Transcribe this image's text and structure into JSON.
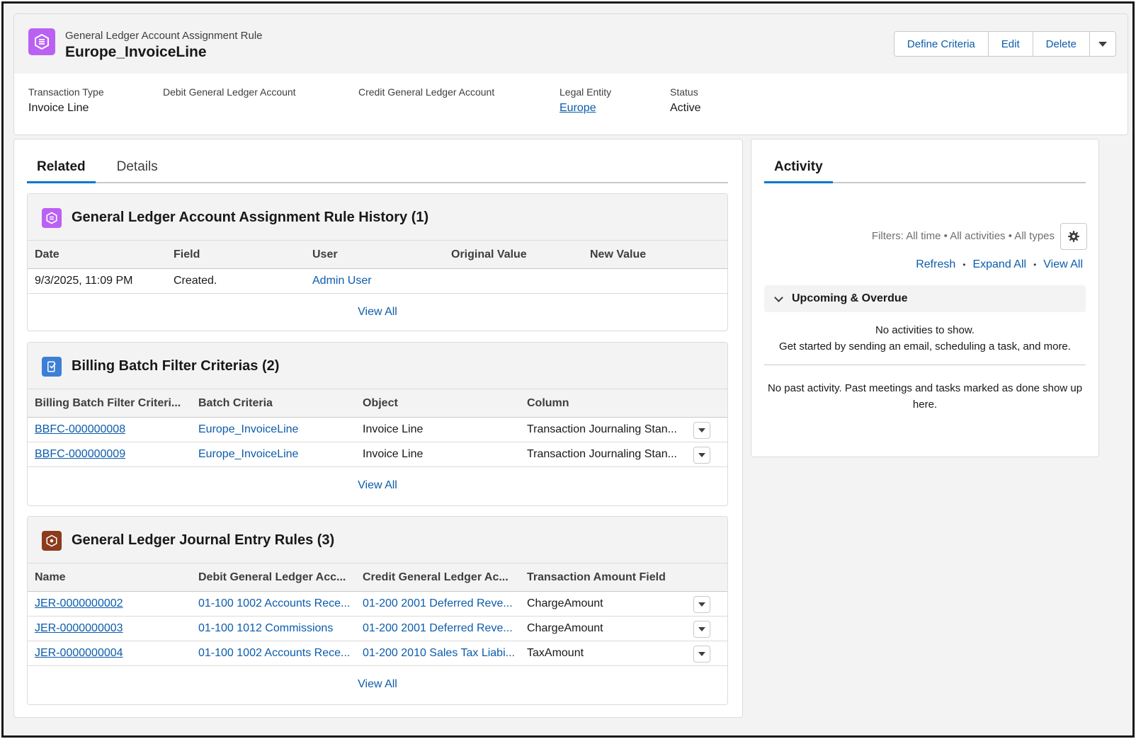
{
  "header": {
    "object_type": "General Ledger Account Assignment Rule",
    "record_name": "Europe_InvoiceLine",
    "icon": "assignment-rule-icon",
    "actions": [
      "Define Criteria",
      "Edit",
      "Delete"
    ],
    "fields": [
      {
        "label": "Transaction Type",
        "value": "Invoice Line"
      },
      {
        "label": "Debit General Ledger Account",
        "value": ""
      },
      {
        "label": "Credit General Ledger Account",
        "value": ""
      },
      {
        "label": "Legal Entity",
        "value": "Europe"
      },
      {
        "label": "Status",
        "value": "Active"
      }
    ]
  },
  "tabs": [
    "Related",
    "Details"
  ],
  "history": {
    "title": "General Ledger Account Assignment Rule History (1)",
    "columns": [
      "Date",
      "Field",
      "User",
      "Original Value",
      "New Value"
    ],
    "rows": [
      [
        "9/3/2025, 11:09 PM",
        "Created.",
        "Admin User",
        "",
        ""
      ]
    ],
    "view_all": "View All"
  },
  "filter_criterias": {
    "title": "Billing Batch Filter Criterias (2)",
    "columns": [
      "Billing Batch Filter Criteri...",
      "Batch Criteria",
      "Object",
      "Column"
    ],
    "rows": [
      [
        "BBFC-000000008",
        "Europe_InvoiceLine",
        "Invoice Line",
        "Transaction Journaling Stan..."
      ],
      [
        "BBFC-000000009",
        "Europe_InvoiceLine",
        "Invoice Line",
        "Transaction Journaling Stan..."
      ]
    ],
    "view_all": "View All"
  },
  "journal_rules": {
    "title": "General Ledger Journal Entry Rules (3)",
    "columns": [
      "Name",
      "Debit General Ledger Acc...",
      "Credit General Ledger Ac...",
      "Transaction Amount Field"
    ],
    "rows": [
      [
        "JER-0000000002",
        "01-100 1002 Accounts Rece...",
        "01-200 2001 Deferred Reve...",
        "ChargeAmount"
      ],
      [
        "JER-0000000003",
        "01-100 1012 Commissions",
        "01-200 2001 Deferred Reve...",
        "ChargeAmount"
      ],
      [
        "JER-0000000004",
        "01-100 1002 Accounts Rece...",
        "01-200 2010 Sales Tax Liabi...",
        "TaxAmount"
      ]
    ],
    "view_all": "View All"
  },
  "activity": {
    "tab": "Activity",
    "filters": "Filters: All time • All activities • All types",
    "links": [
      "Refresh",
      "Expand All",
      "View All"
    ],
    "upcoming": "Upcoming & Overdue",
    "no_activities": "No activities to show.",
    "get_started": "Get started by sending an email, scheduling a task, and more.",
    "no_past": "No past activity. Past meetings and tasks marked as done show up here."
  },
  "colors": {
    "brand": "#0176d3",
    "link": "#0b5cab",
    "rule_icon": "#ba61f3",
    "filter_icon": "#3c7fd6",
    "journal_icon": "#8c3b1c"
  }
}
